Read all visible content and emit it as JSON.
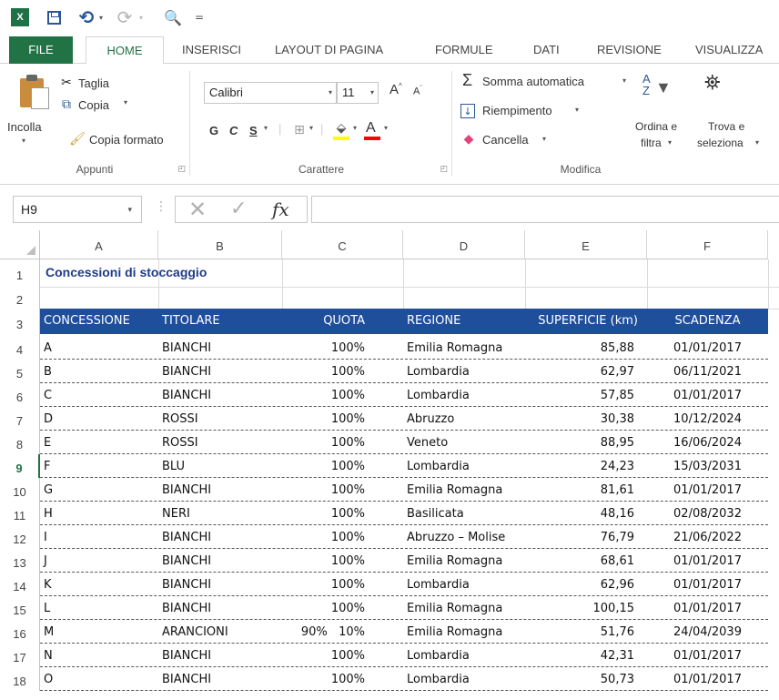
{
  "qat": {
    "logo": "X",
    "undo": "⟲",
    "redo": "⟳",
    "more": "="
  },
  "tabs": [
    "FILE",
    "HOME",
    "INSERISCI",
    "LAYOUT DI PAGINA",
    "FORMULE",
    "DATI",
    "REVISIONE",
    "VISUALIZZA"
  ],
  "ribbon": {
    "clipboard": {
      "paste": "Incolla",
      "cut": "Taglia",
      "copy": "Copia",
      "format_painter": "Copia formato",
      "label": "Appunti"
    },
    "font": {
      "font_name": "Calibri",
      "font_size": "11",
      "bold": "G",
      "italic": "C",
      "underline": "S",
      "label": "Carattere"
    },
    "editing": {
      "autosum": "Somma automatica",
      "fill": "Riempimento",
      "clear": "Cancella",
      "sort_line1": "Ordina e",
      "sort_line2": "filtra",
      "find_line1": "Trova e",
      "find_line2": "seleziona",
      "label": "Modifica"
    }
  },
  "formula_bar": {
    "name_box": "H9",
    "fx": "fx",
    "content": ""
  },
  "sheet": {
    "columns": [
      "A",
      "B",
      "C",
      "D",
      "E",
      "F"
    ],
    "row_numbers": [
      "1",
      "2",
      "3",
      "4",
      "5",
      "6",
      "7",
      "8",
      "9",
      "10",
      "11",
      "12",
      "13",
      "14",
      "15",
      "16",
      "17",
      "18"
    ],
    "active_row": "9",
    "title": "Concessioni di stoccaggio",
    "headers": [
      "CONCESSIONE",
      "TITOLARE",
      "QUOTA",
      "REGIONE",
      "SUPERFICIE (km)",
      "SCADENZA"
    ],
    "rows": [
      [
        "A",
        "BIANCHI",
        "100%",
        "Emilia Romagna",
        "85,88",
        "01/01/2017"
      ],
      [
        "B",
        "BIANCHI",
        "100%",
        "Lombardia",
        "62,97",
        "06/11/2021"
      ],
      [
        "C",
        "BIANCHI",
        "100%",
        "Lombardia",
        "57,85",
        "01/01/2017"
      ],
      [
        "D",
        "ROSSI",
        "100%",
        "Abruzzo",
        "30,38",
        "10/12/2024"
      ],
      [
        "E",
        "ROSSI",
        "100%",
        "Veneto",
        "88,95",
        "16/06/2024"
      ],
      [
        "F",
        "BLU",
        "100%",
        "Lombardia",
        "24,23",
        "15/03/2031"
      ],
      [
        "G",
        "BIANCHI",
        "100%",
        "Emilia Romagna",
        "81,61",
        "01/01/2017"
      ],
      [
        "H",
        "NERI",
        "100%",
        "Basilicata",
        "48,16",
        "02/08/2032"
      ],
      [
        "I",
        "BIANCHI",
        "100%",
        "Abruzzo – Molise",
        "76,79",
        "21/06/2022"
      ],
      [
        "J",
        "BIANCHI",
        "100%",
        "Emilia Romagna",
        "68,61",
        "01/01/2017"
      ],
      [
        "K",
        "BIANCHI",
        "100%",
        "Lombardia",
        "62,96",
        "01/01/2017"
      ],
      [
        "L",
        "BIANCHI",
        "100%",
        "Emilia Romagna",
        "100,15",
        "01/01/2017"
      ],
      [
        "M",
        "ARANCIONI",
        "90%   10%",
        "Emilia Romagna",
        "51,76",
        "24/04/2039"
      ],
      [
        "N",
        "BIANCHI",
        "100%",
        "Lombardia",
        "42,31",
        "01/01/2017"
      ],
      [
        "O",
        "BIANCHI",
        "100%",
        "Lombardia",
        "50,73",
        "01/01/2017"
      ]
    ]
  },
  "colors": {
    "excel_green": "#217346",
    "header_blue": "#1f4e9a",
    "title_blue": "#1f3b8a"
  }
}
